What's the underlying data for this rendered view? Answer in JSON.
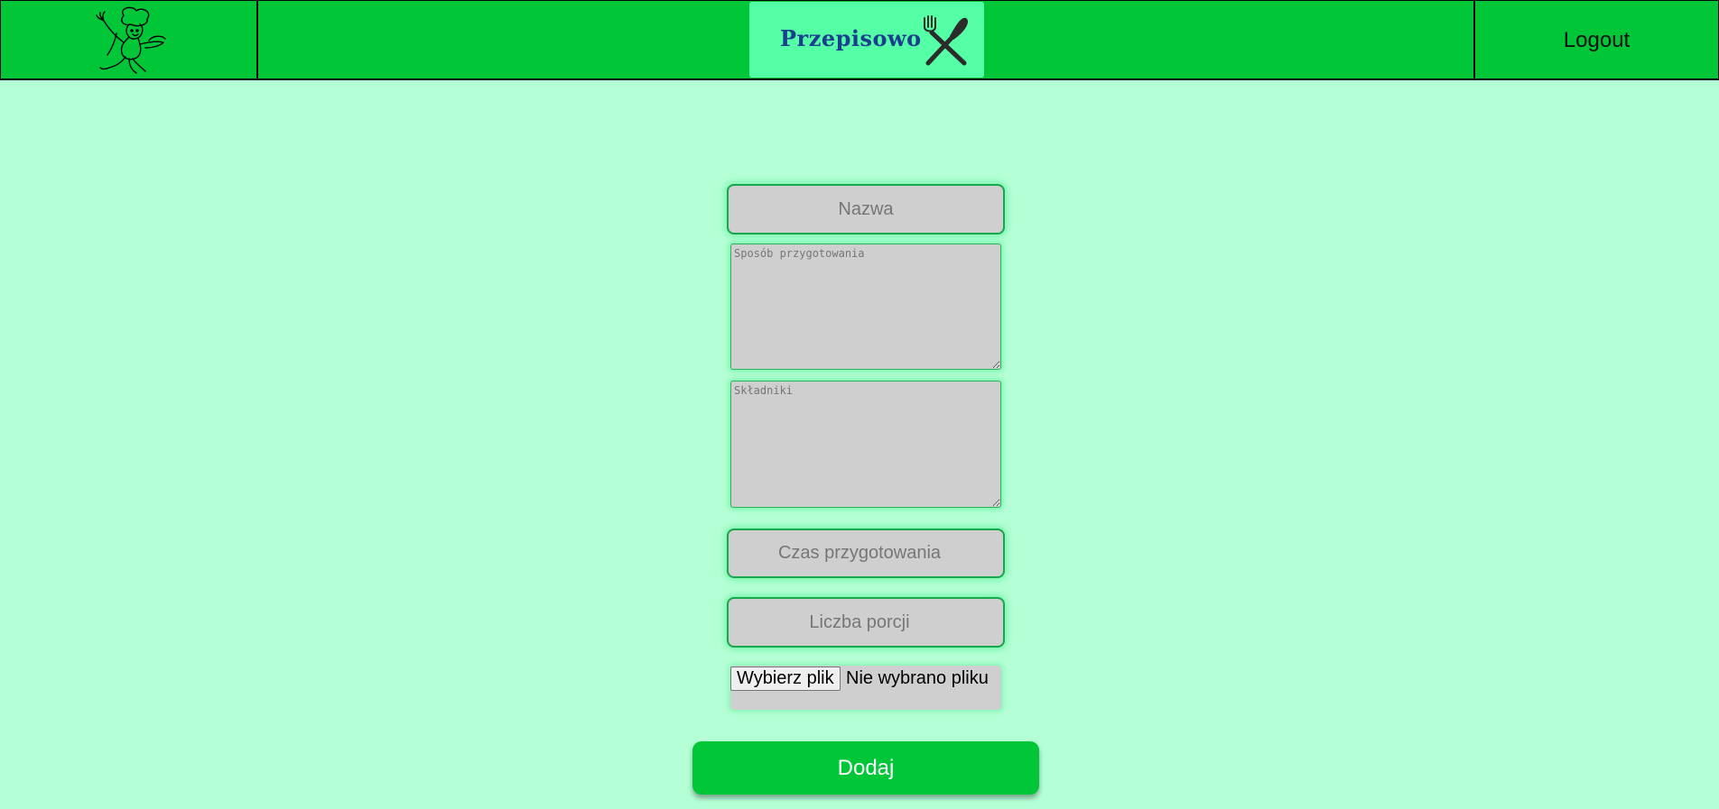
{
  "header": {
    "brand": "Przepisowo",
    "logout_label": "Logout",
    "logo_icon": "chef-icon",
    "brand_icon": "fork-knife-icon",
    "colors": {
      "header_bg": "#00c638",
      "brand_bg": "#55ffa6",
      "brand_text": "#1b3f8e",
      "page_bg": "#b5ffd6"
    }
  },
  "form": {
    "name_placeholder": "Nazwa",
    "preparation_placeholder": "Sposób przygotowania",
    "ingredients_placeholder": "Składniki",
    "time_placeholder": "Czas przygotowania",
    "servings_placeholder": "Liczba porcji",
    "file_button_label": "Wybierz plik",
    "file_status": "Nie wybrano pliku",
    "submit_label": "Dodaj"
  }
}
